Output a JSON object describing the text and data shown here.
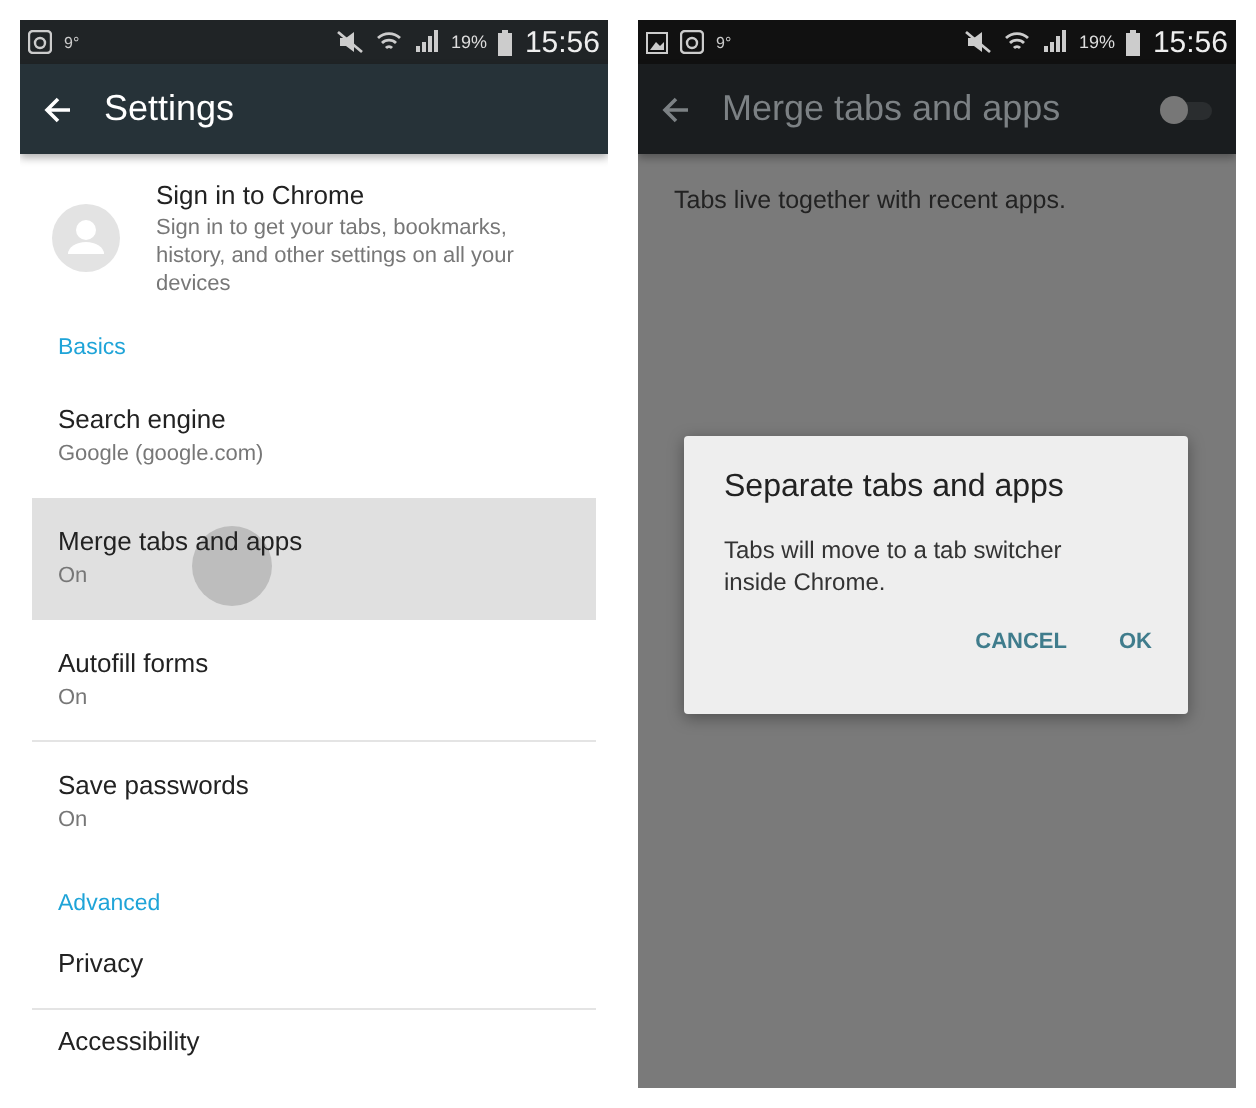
{
  "left": {
    "status_bar": {
      "temperature": "9°",
      "battery": "19%",
      "time": "15:56"
    },
    "toolbar": {
      "title": "Settings"
    },
    "account": {
      "title": "Sign in to Chrome",
      "subtitle": "Sign in to get your tabs, bookmarks, history, and other settings on all your devices"
    },
    "sections": [
      {
        "header": "Basics",
        "items": [
          {
            "title": "Search engine",
            "summary": "Google (google.com)",
            "pressed": false,
            "divider": false
          },
          {
            "title": "Merge tabs and apps",
            "summary": "On",
            "pressed": true,
            "divider": false
          },
          {
            "title": "Autofill forms",
            "summary": "On",
            "pressed": false,
            "divider": true
          },
          {
            "title": "Save passwords",
            "summary": "On",
            "pressed": false,
            "divider": false
          }
        ]
      },
      {
        "header": "Advanced",
        "items": [
          {
            "title": "Privacy",
            "pressed": false,
            "divider": true
          },
          {
            "title": "Accessibility",
            "pressed": false,
            "divider": false
          }
        ]
      }
    ]
  },
  "right": {
    "status_bar": {
      "temperature": "9°",
      "battery": "19%",
      "time": "15:56"
    },
    "toolbar": {
      "title": "Merge tabs and apps",
      "switch_on": false
    },
    "description": "Tabs live together with recent apps.",
    "dialog": {
      "title": "Separate tabs and apps",
      "message": "Tabs will move to a tab switcher inside Chrome.",
      "buttons": [
        "CANCEL",
        "OK"
      ]
    }
  }
}
